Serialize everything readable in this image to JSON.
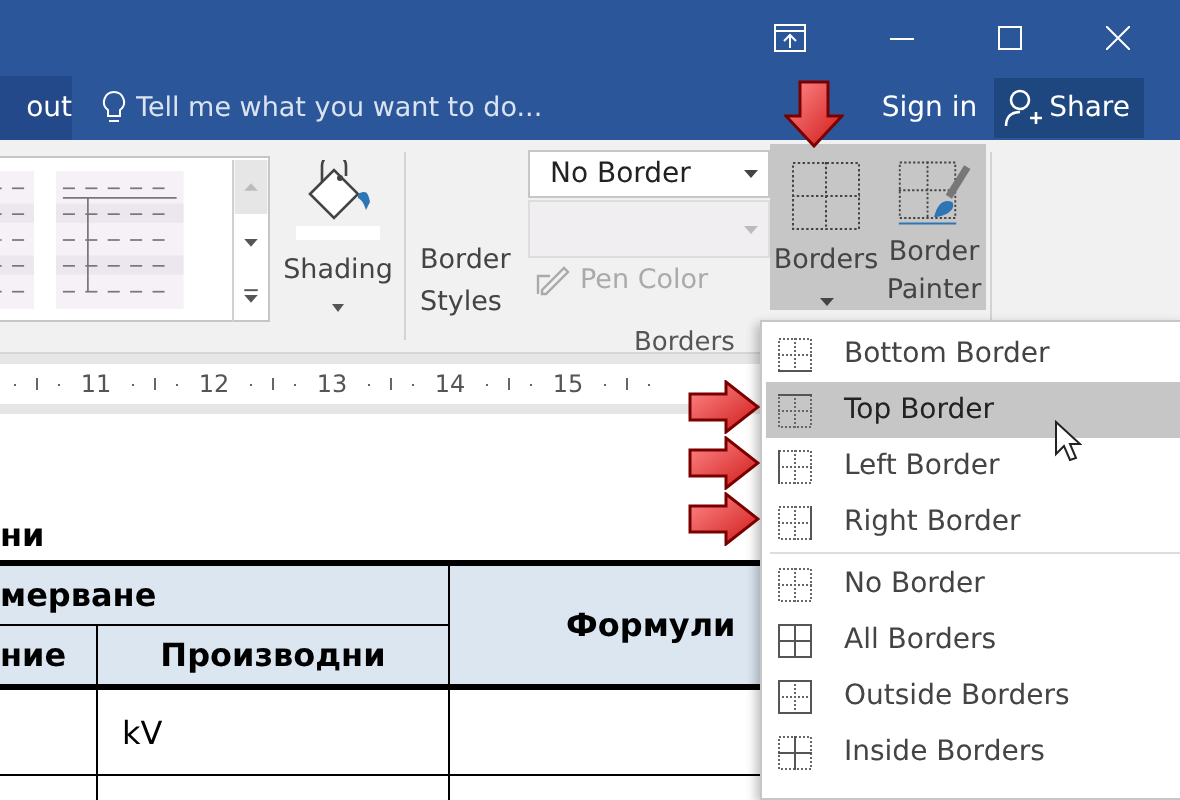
{
  "window": {
    "controls": [
      {
        "kind": "ribbon-display"
      },
      {
        "kind": "minimize"
      },
      {
        "kind": "maximize"
      },
      {
        "kind": "close"
      }
    ]
  },
  "tab_row": {
    "partial_tab": "out",
    "tell_me": {
      "placeholder": "Tell me what you want to do..."
    },
    "sign_in": "Sign in",
    "share": "Share"
  },
  "ribbon": {
    "shading": {
      "label": "Shading"
    },
    "border_styles": {
      "label": "Border Styles"
    },
    "pen_style": {
      "value": "No Border"
    },
    "pen_weight": {
      "disabled": true
    },
    "pen_color": {
      "label": "Pen Color",
      "disabled": true
    },
    "borders": {
      "label": "Borders",
      "selected": true
    },
    "border_painter": {
      "label": "Border Painter",
      "selected": true
    },
    "group_label": "Borders"
  },
  "ruler": {
    "numbers": [
      "11",
      "12",
      "13",
      "14",
      "15"
    ]
  },
  "document": {
    "heading": "ни",
    "table": {
      "header_top": [
        "мерване",
        "Формули"
      ],
      "header_sub": [
        "ние",
        "Производни"
      ],
      "rows": [
        [
          "",
          "kV",
          ""
        ],
        [
          "",
          "",
          ""
        ]
      ]
    }
  },
  "borders_menu": {
    "items": [
      {
        "label": "Bottom Border",
        "kind": "bottom",
        "selected": false
      },
      {
        "label": "Top Border",
        "kind": "top",
        "selected": true
      },
      {
        "label": "Left Border",
        "kind": "left",
        "selected": false
      },
      {
        "label": "Right Border",
        "kind": "right",
        "selected": false
      },
      {
        "label": "No Border",
        "kind": "none",
        "selected": false
      },
      {
        "label": "All Borders",
        "kind": "all",
        "selected": false
      },
      {
        "label": "Outside Borders",
        "kind": "outside",
        "selected": false
      },
      {
        "label": "Inside Borders",
        "kind": "inside",
        "selected": false
      }
    ]
  },
  "callouts": [
    {
      "kind": "down"
    },
    {
      "kind": "right"
    },
    {
      "kind": "right"
    },
    {
      "kind": "right"
    }
  ]
}
